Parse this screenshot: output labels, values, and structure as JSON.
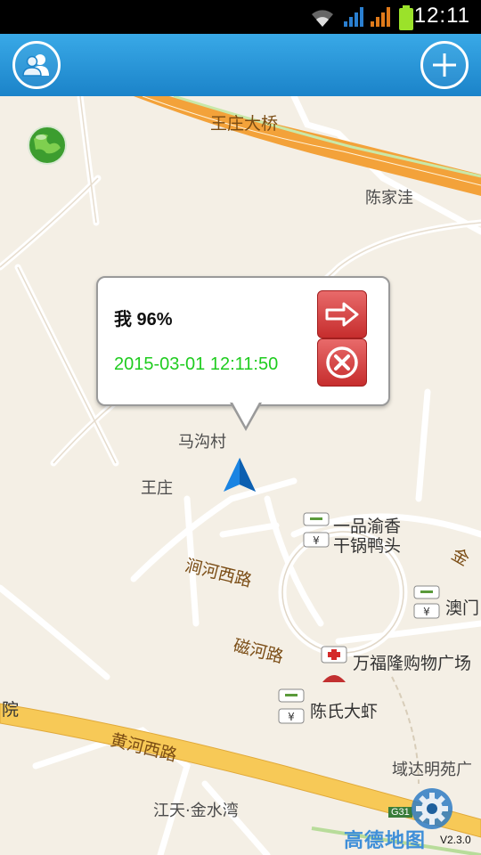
{
  "status": {
    "time": "12:11"
  },
  "header": {
    "people_button": "people-icon",
    "add_button": "plus-icon"
  },
  "popup": {
    "name": "我 96%",
    "timestamp": "2015-03-01  12:11:50"
  },
  "map": {
    "labels": {
      "wangzhuang_bridge": "王庄大桥",
      "chenjiawa": "陈家洼",
      "magoucun": "马沟村",
      "wangzhuang": "王庄",
      "jianhe_west_road": "涧河西路",
      "cihe_road": "磁河路",
      "yipin_yuxiang": "一品渝香",
      "ganguo_yatou": "干锅鸭头",
      "aomen": "澳门",
      "jin": "金",
      "wanfulong": "万福隆购物广场",
      "chenshi_daxia": "陈氏大虾",
      "huanghe_west_road": "黄河西路",
      "yuan": "院",
      "yuda_mingyuan": "域达明苑广",
      "jiangtian_jinshuiwan": "江天·金水湾",
      "g31": "G31"
    }
  },
  "logo": {
    "text": "高德地图",
    "version": "V2.3.0"
  },
  "colors": {
    "appbar": "#1b83c9",
    "road_orange": "#f3a23a",
    "popup_time": "#1fcc1f",
    "popup_button": "#c62d2d"
  }
}
